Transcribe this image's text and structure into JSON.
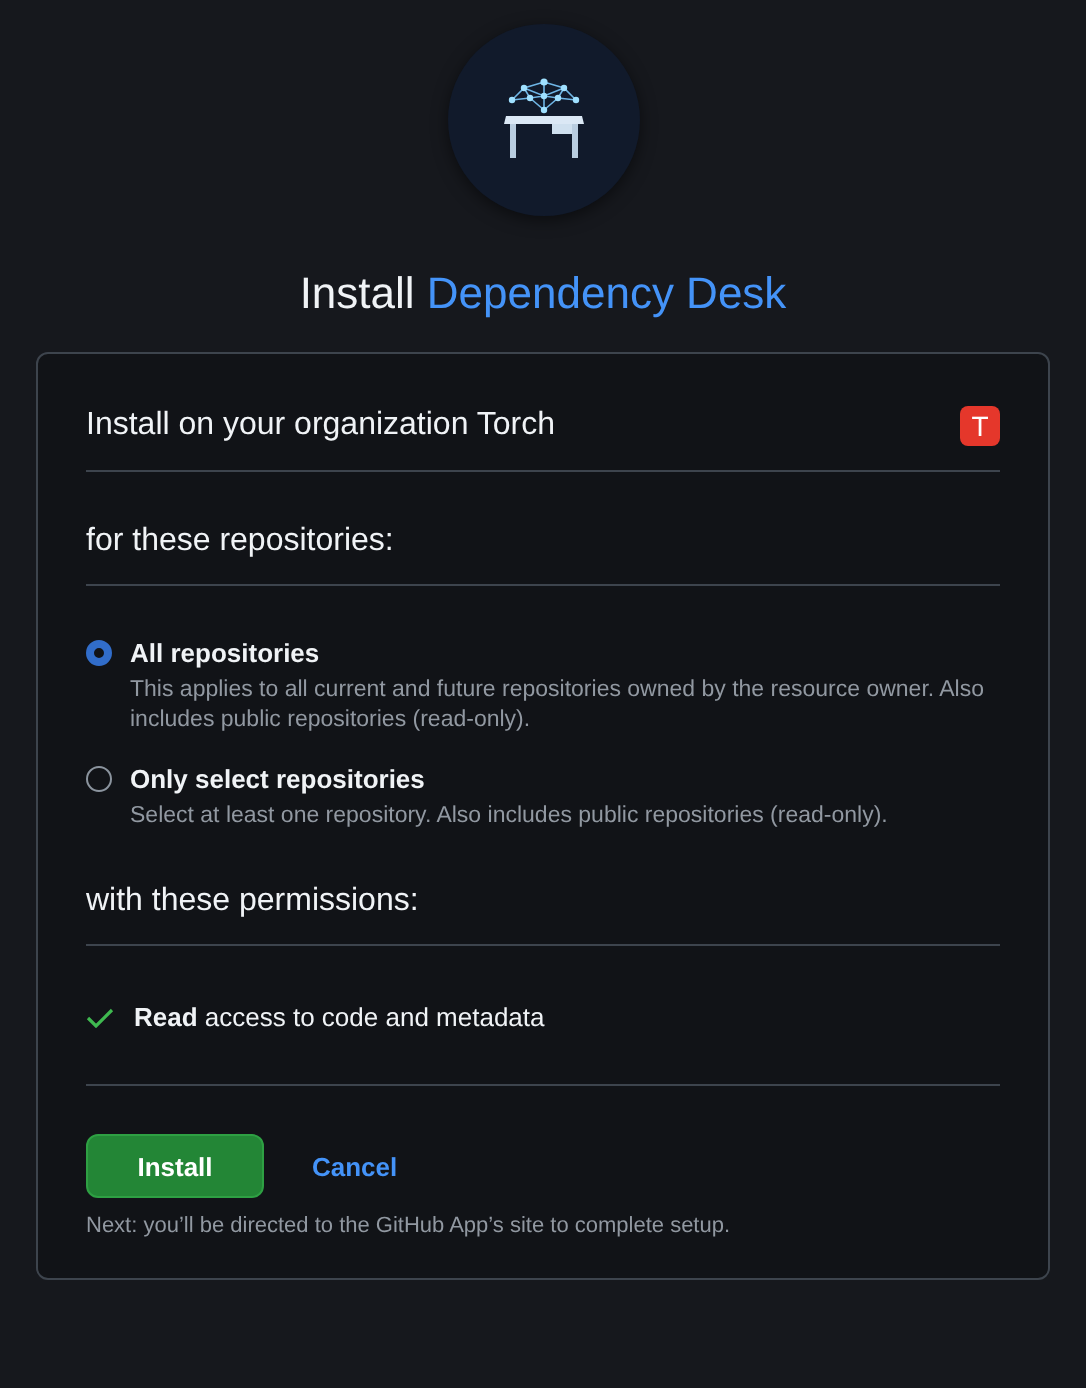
{
  "title": {
    "prefix": "Install",
    "app_name": "Dependency Desk"
  },
  "organization": {
    "label": "Install on your organization Torch",
    "avatar": "T"
  },
  "repositories_heading": "for these repositories:",
  "repository_options": [
    {
      "label": "All repositories",
      "description": "This applies to all current and future repositories owned by the resource owner. Also includes public repositories (read-only).",
      "selected": true
    },
    {
      "label": "Only select repositories",
      "description": "Select at least one repository. Also includes public repositories (read-only).",
      "selected": false
    }
  ],
  "permissions_heading": "with these permissions:",
  "permissions": [
    {
      "text": "**Read** access to code and metadata"
    }
  ],
  "buttons": {
    "install": "Install",
    "cancel": "Cancel"
  },
  "note": "Next: you’ll be directed to the GitHub App’s site to complete setup."
}
